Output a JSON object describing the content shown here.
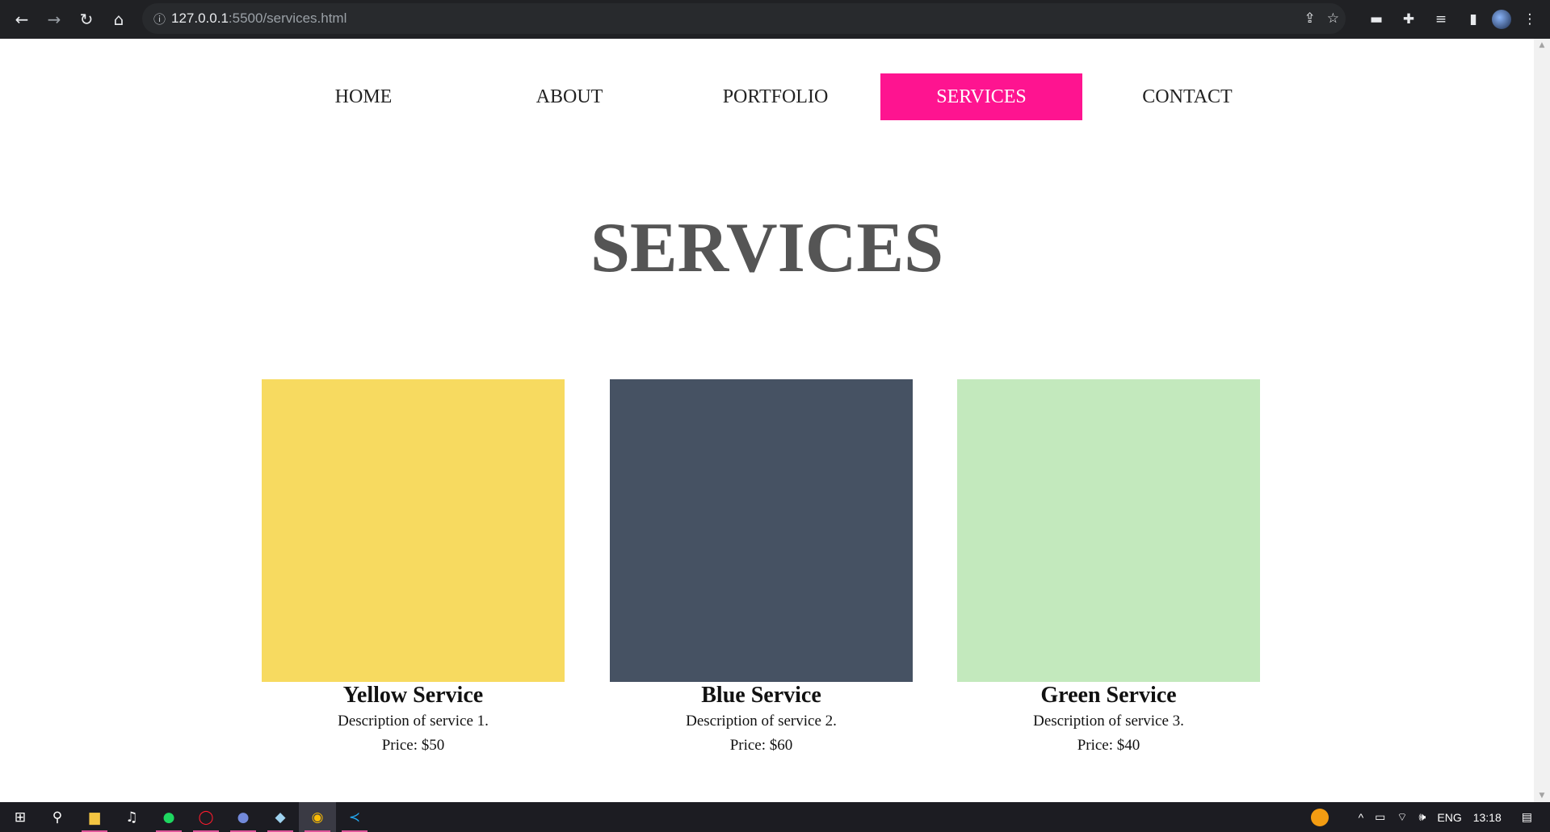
{
  "browser": {
    "url_host": "127.0.0.1",
    "url_path": ":5500/services.html",
    "icons": [
      "back-icon",
      "forward-icon",
      "reload-icon",
      "home-icon",
      "info-icon",
      "share-icon",
      "star-icon",
      "extension-icon",
      "puzzle-icon",
      "media-icon",
      "sidepanel-icon",
      "avatar",
      "menu-icon"
    ]
  },
  "nav": {
    "items": [
      {
        "label": "HOME"
      },
      {
        "label": "ABOUT"
      },
      {
        "label": "PORTFOLIO"
      },
      {
        "label": "SERVICES",
        "active": true
      },
      {
        "label": "CONTACT"
      }
    ],
    "active_color": "#fe1490"
  },
  "page": {
    "title": "SERVICES"
  },
  "services": [
    {
      "name": "Yellow Service",
      "description": "Description of service 1.",
      "price": "Price: $50",
      "color": "#f7da60"
    },
    {
      "name": "Blue Service",
      "description": "Description of service 2.",
      "price": "Price: $60",
      "color": "#465263"
    },
    {
      "name": "Green Service",
      "description": "Description of service 3.",
      "price": "Price: $40",
      "color": "#c3e9bd"
    }
  ],
  "taskbar": {
    "apps": [
      "windows-start-icon",
      "search-icon",
      "file-explorer-icon",
      "itunes-icon",
      "spotify-icon",
      "opera-icon",
      "discord-icon",
      "notes-icon",
      "chrome-icon",
      "vscode-icon"
    ],
    "language": "ENG",
    "time": "13:18"
  }
}
